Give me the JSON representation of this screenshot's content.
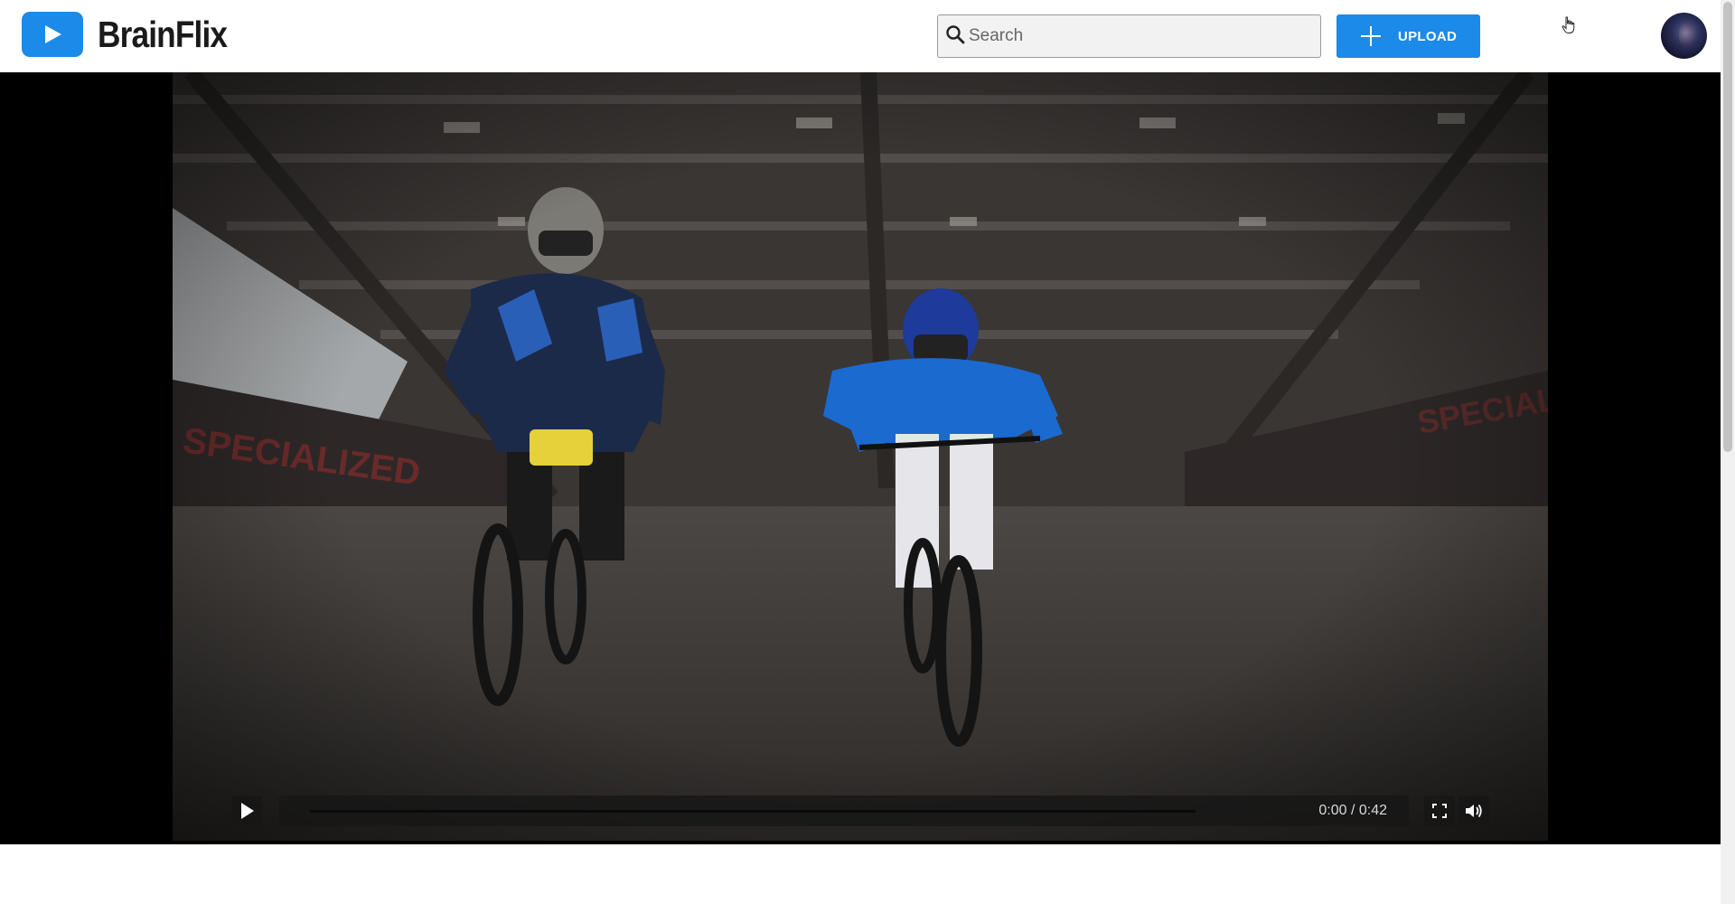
{
  "app": {
    "name": "BrainFlix"
  },
  "search": {
    "placeholder": "Search"
  },
  "upload": {
    "label": "UPLOAD"
  },
  "player": {
    "time_display": "0:00 / 0:42",
    "progress": 0
  },
  "colors": {
    "brand": "#1c8ae8",
    "text": "#1a1a1a"
  },
  "icons": [
    "play-icon",
    "search-icon",
    "plus-icon",
    "fullscreen-icon",
    "volume-icon",
    "hand-cursor-icon"
  ]
}
